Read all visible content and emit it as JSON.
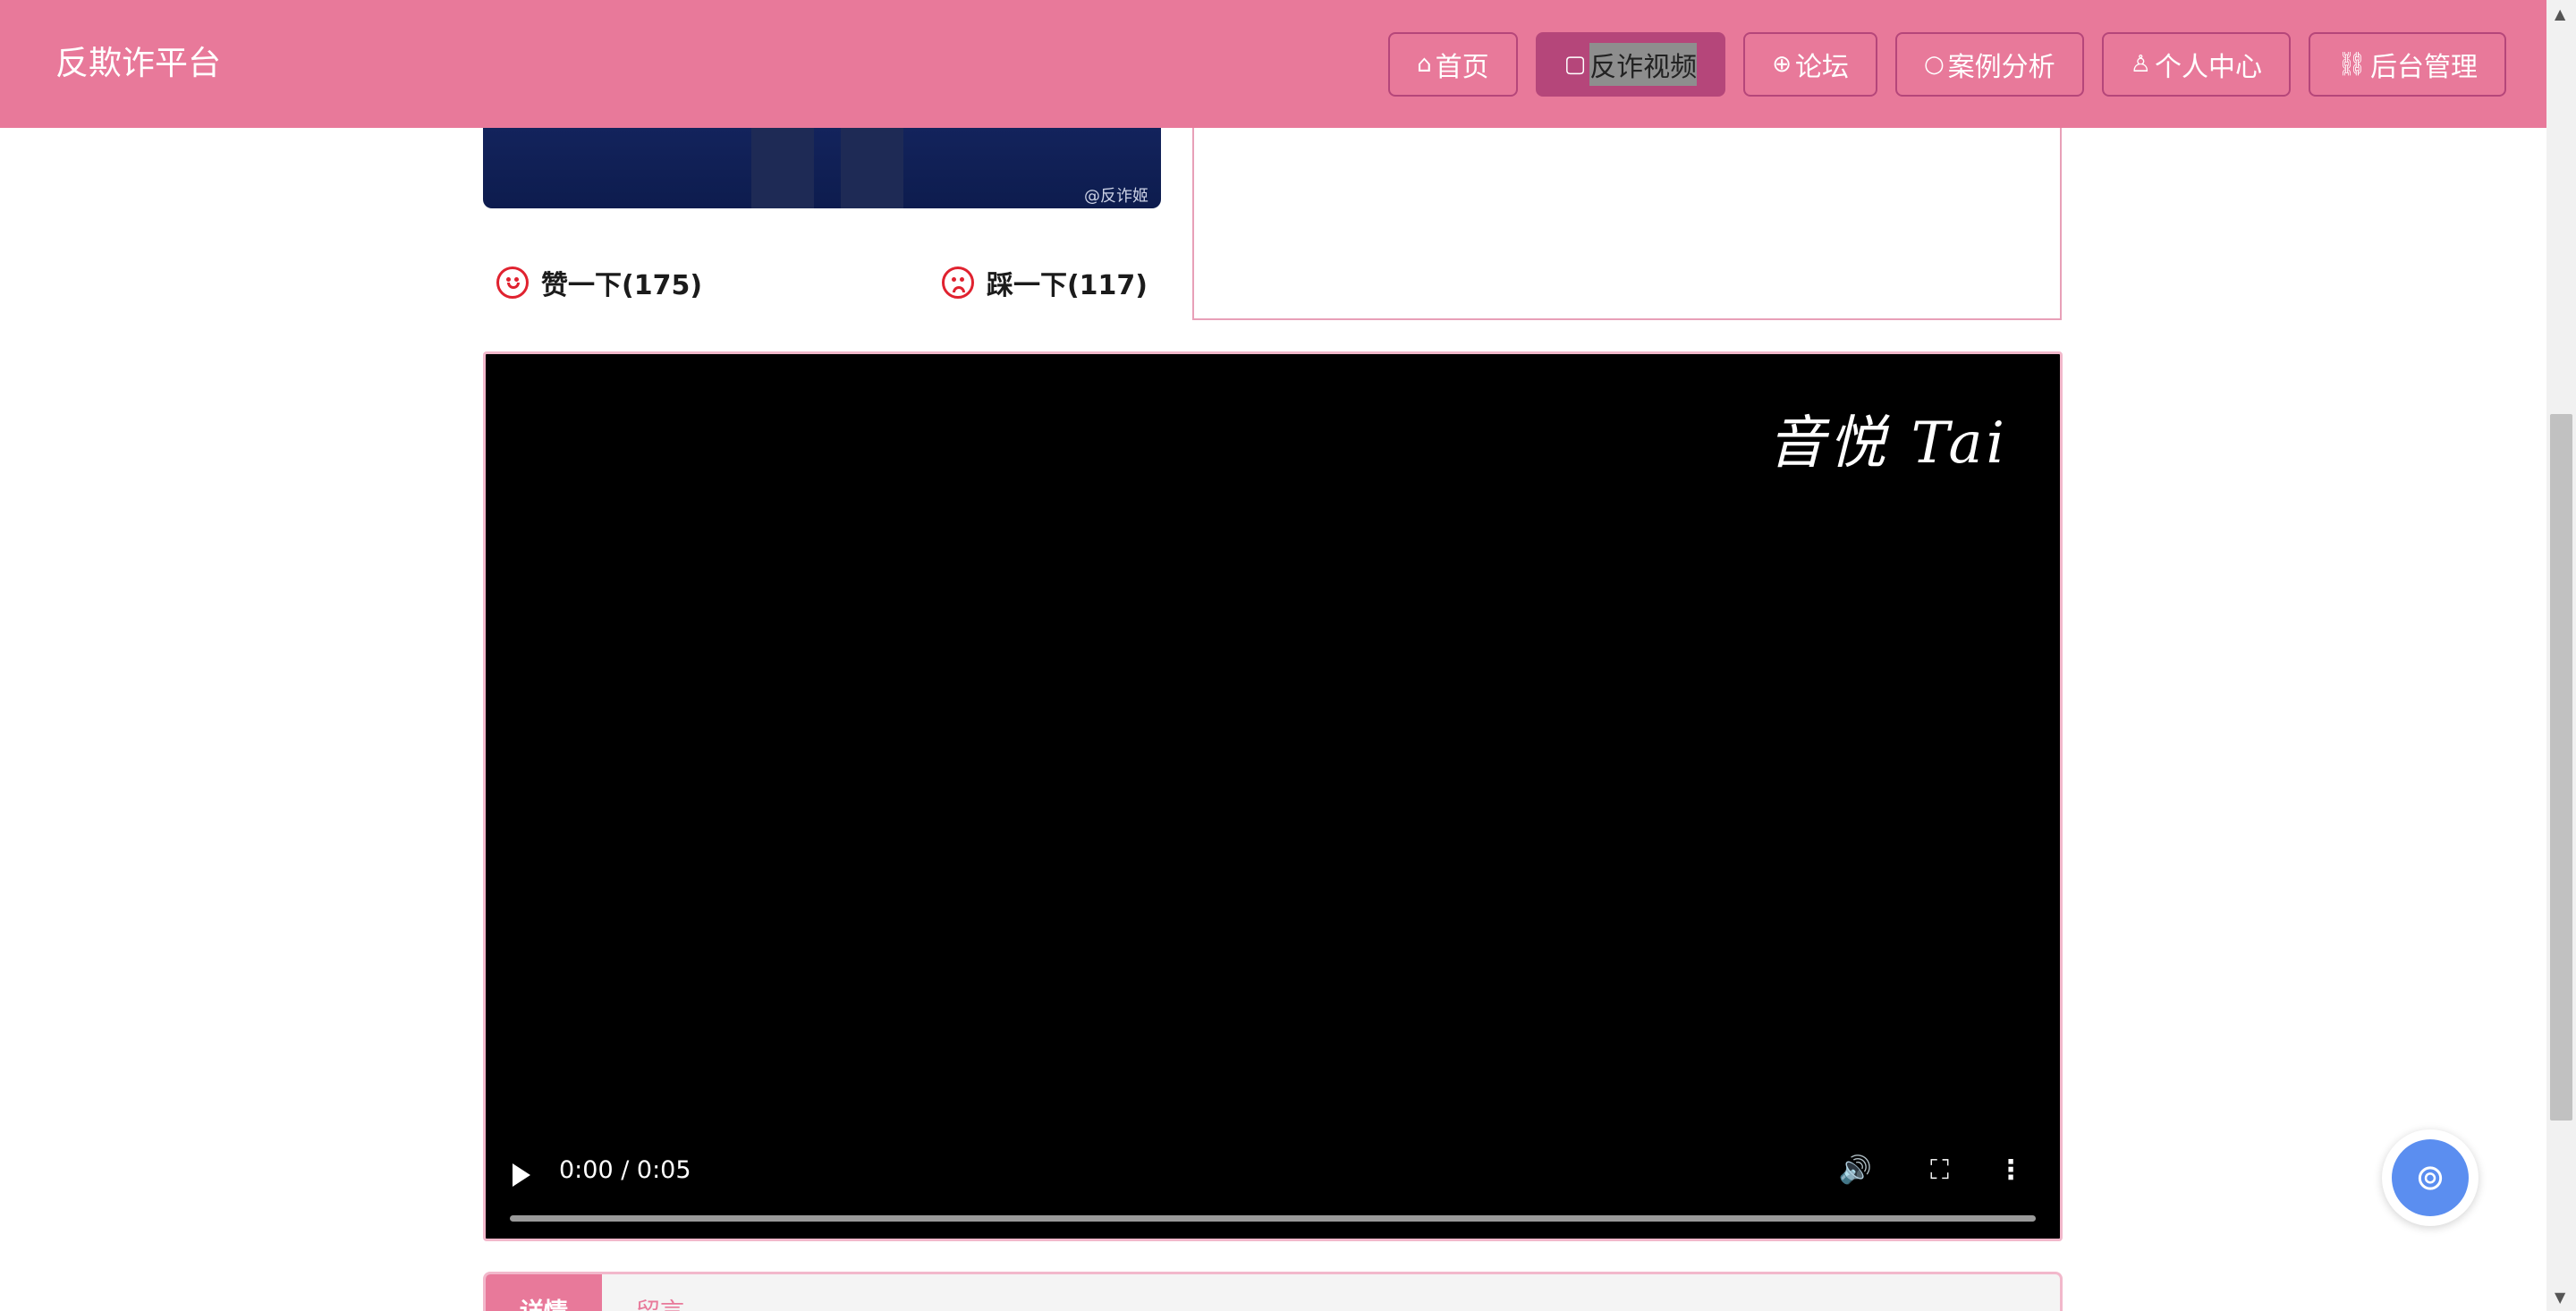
{
  "header": {
    "brand": "反欺诈平台",
    "nav": [
      {
        "icon": "⌂",
        "label": "首页"
      },
      {
        "icon": "▢",
        "label": "反诈视频"
      },
      {
        "icon": "⊕",
        "label": "论坛"
      },
      {
        "icon": "○",
        "label": "案例分析"
      },
      {
        "icon": "♙",
        "label": "个人中心"
      },
      {
        "icon": "⛓",
        "label": "后台管理"
      }
    ]
  },
  "cover": {
    "watermark": "@反诈姬"
  },
  "votes": {
    "like_label": "赞一下(175)",
    "dislike_label": "踩一下(117)"
  },
  "video": {
    "logo_text": "音悦 Tai",
    "time": "0:00 / 0:05",
    "progress": 0
  },
  "tabs": {
    "details": "详情",
    "comments": "留言"
  },
  "colors": {
    "header": "#e8799a",
    "nav_active": "#b5467a",
    "vote_icon": "#e0222f",
    "fab": "#5b8ef0"
  }
}
